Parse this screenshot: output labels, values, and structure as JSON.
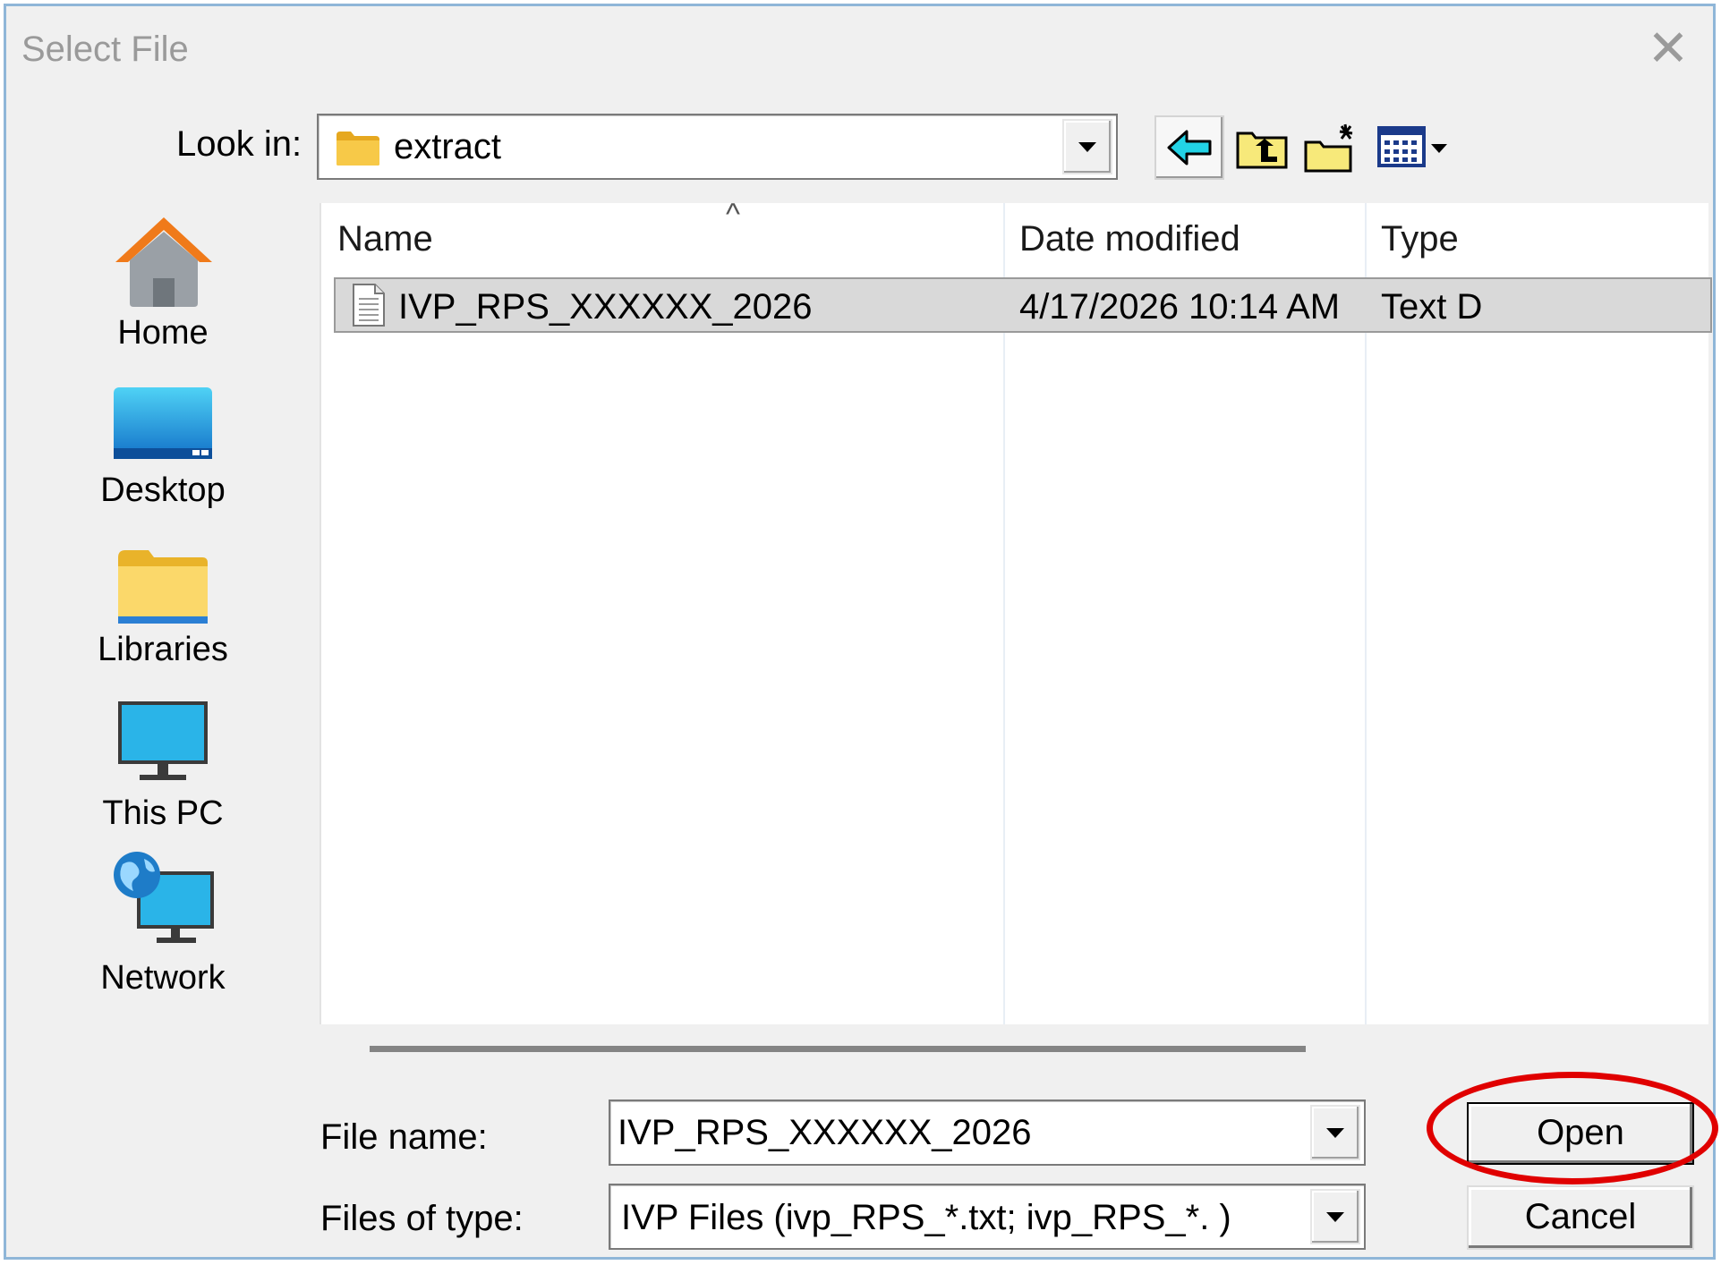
{
  "window": {
    "title": "Select File"
  },
  "lookin": {
    "label": "Look in:",
    "value": "extract"
  },
  "toolbar": {
    "items": [
      "back-icon",
      "up-folder-icon",
      "new-folder-icon",
      "view-menu-icon"
    ]
  },
  "places": [
    {
      "label": "Home",
      "icon": "home-icon"
    },
    {
      "label": "Desktop",
      "icon": "desktop-icon"
    },
    {
      "label": "Libraries",
      "icon": "libraries-icon"
    },
    {
      "label": "This PC",
      "icon": "this-pc-icon"
    },
    {
      "label": "Network",
      "icon": "network-icon"
    }
  ],
  "columns": [
    "Name",
    "Date modified",
    "Type"
  ],
  "files": [
    {
      "name": "IVP_RPS_XXXXXX_2026",
      "date_modified": "4/17/2026 10:14 AM",
      "type": "Text D",
      "icon": "text-file-icon"
    }
  ],
  "filename": {
    "label": "File name:",
    "value": "IVP_RPS_XXXXXX_2026"
  },
  "filetype": {
    "label": "Files of type:",
    "value": "IVP Files (ivp_RPS_*.txt; ivp_RPS_*. )"
  },
  "buttons": {
    "open": "Open",
    "cancel": "Cancel"
  },
  "colors": {
    "annotation": "#e00000",
    "row_selected": "#d9d9d9",
    "folder": "#f4c542"
  }
}
